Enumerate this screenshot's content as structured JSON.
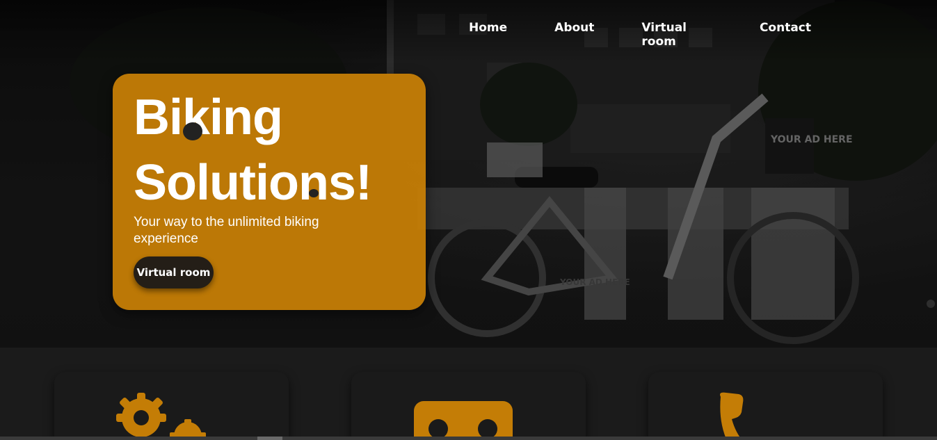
{
  "nav": {
    "items": [
      {
        "label": "Home"
      },
      {
        "label": "About"
      },
      {
        "label": "Virtual room"
      },
      {
        "label": "Contact"
      }
    ]
  },
  "hero": {
    "title_line1": "Biking",
    "title_line2": "Solutions!",
    "subtitle": "Your way to the unlimited biking experience",
    "cta_label": "Virtual room",
    "photo_sign_1": "YOUR AD HERE",
    "photo_sign_2": "YOUR AD HERE"
  },
  "features": [
    {
      "icon": "gears-icon"
    },
    {
      "icon": "vr-headset-icon"
    },
    {
      "icon": "phone-icon"
    }
  ],
  "colors": {
    "accent": "#c47d06",
    "background": "#1b1b1b",
    "button_dark": "#241e17"
  }
}
